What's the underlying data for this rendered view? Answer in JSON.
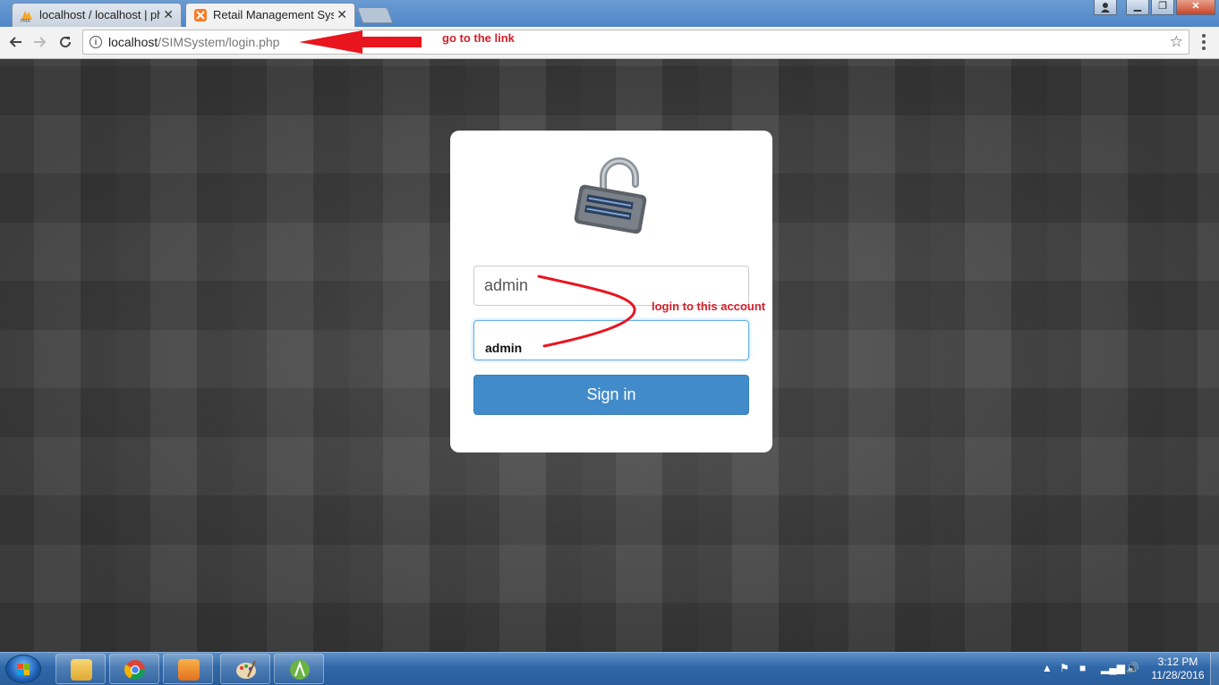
{
  "browser": {
    "tabs": [
      {
        "label": "localhost / localhost | ph",
        "icon": "phpmyadmin-icon",
        "close": "✕"
      },
      {
        "label": "Retail Management Syste",
        "icon": "xampp-icon",
        "close": "✕"
      }
    ],
    "url": {
      "host": "localhost",
      "path": "/SIMSystem/login.php"
    }
  },
  "login": {
    "username_value": "admin",
    "password_value": "admin",
    "signin_label": "Sign in"
  },
  "annotations": {
    "link_note": "go to the link",
    "account_note": "login to this account",
    "color": "#d21f2a"
  },
  "taskbar": {
    "apps": [
      "file-explorer-icon",
      "chrome-icon",
      "media-player-icon",
      "paint-icon",
      "android-studio-icon"
    ],
    "clock_time": "3:12 PM",
    "clock_date": "11/28/2016"
  },
  "colors": {
    "signin_button": "#428bca",
    "focus_border": "#66afe9"
  }
}
